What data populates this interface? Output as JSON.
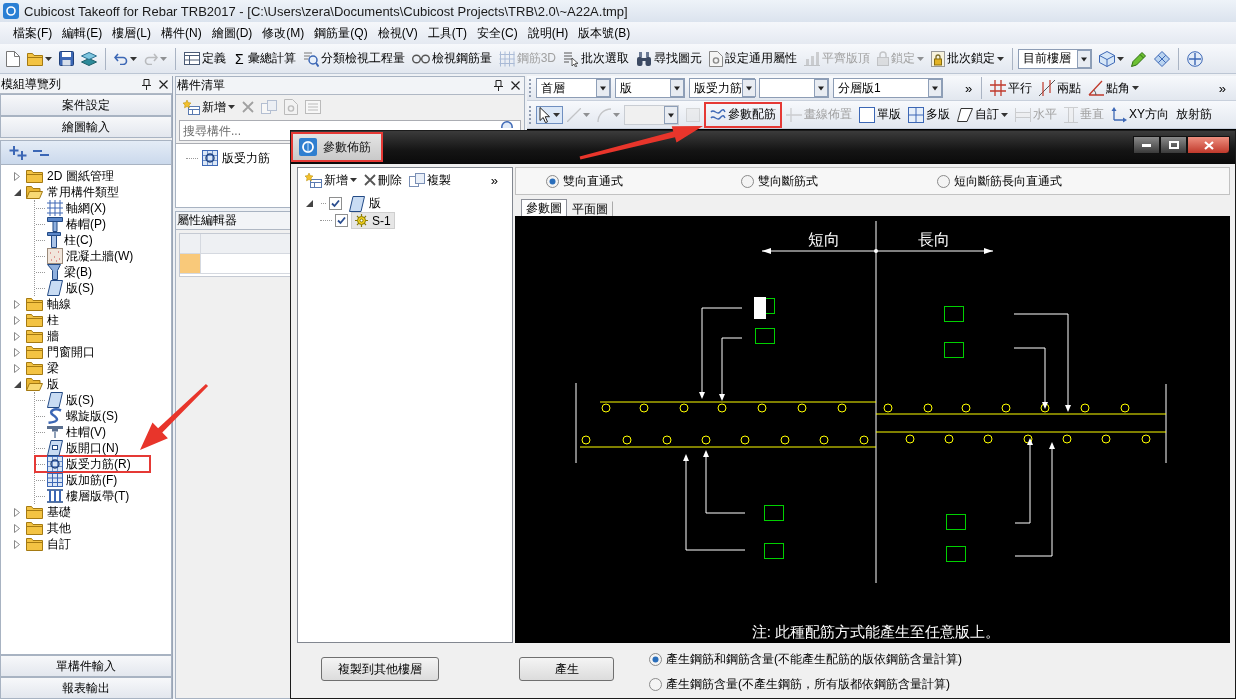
{
  "window": {
    "title": "Cubicost Takeoff for Rebar TRB2017 - [C:\\Users\\zera\\Documents\\Cubicost Projects\\TRB\\2.0\\~A22A.tmp]"
  },
  "menu_bar": [
    "檔案(F)",
    "編輯(E)",
    "樓層(L)",
    "構件(N)",
    "繪圖(D)",
    "修改(M)",
    "鋼筋量(Q)",
    "檢視(V)",
    "工具(T)",
    "安全(C)",
    "說明(H)",
    "版本號(B)"
  ],
  "main_toolbar": [
    {
      "kind": "icon",
      "disabled": false,
      "dropdown": false
    },
    {
      "kind": "icon",
      "disabled": false,
      "dropdown": true
    },
    {
      "kind": "icon",
      "disabled": false,
      "dropdown": false
    },
    {
      "kind": "icon",
      "disabled": false,
      "dropdown": false
    },
    {
      "kind": "separator"
    },
    {
      "kind": "icon",
      "disabled": false,
      "dropdown": true
    },
    {
      "kind": "icon",
      "disabled": true,
      "dropdown": true
    },
    {
      "kind": "separator"
    },
    {
      "kind": "button",
      "label": "定義",
      "disabled": false,
      "dropdown": false
    },
    {
      "kind": "button",
      "glyph": "Σ",
      "label": "彙總計算",
      "disabled": false,
      "dropdown": false
    },
    {
      "kind": "button",
      "label": "分類檢視工程量",
      "disabled": false,
      "dropdown": false
    },
    {
      "kind": "button",
      "label": "檢視鋼筋量",
      "disabled": false,
      "dropdown": false
    },
    {
      "kind": "button",
      "label": "鋼筋3D",
      "disabled": true,
      "dropdown": false
    },
    {
      "kind": "button",
      "label": "批次選取",
      "disabled": false,
      "dropdown": false
    },
    {
      "kind": "button",
      "label": "尋找圖元",
      "disabled": false,
      "dropdown": false
    },
    {
      "kind": "button",
      "label": "設定通用屬性",
      "disabled": false,
      "dropdown": false
    },
    {
      "kind": "button",
      "label": "平齊版頂",
      "disabled": true,
      "dropdown": false
    },
    {
      "kind": "button",
      "label": "鎖定",
      "disabled": true,
      "dropdown": true
    },
    {
      "kind": "button",
      "label": "批次鎖定",
      "disabled": false,
      "dropdown": true
    },
    {
      "kind": "separator"
    },
    {
      "kind": "combo",
      "value": "目前樓層",
      "disabled": false
    },
    {
      "kind": "icon",
      "disabled": false,
      "dropdown": true
    },
    {
      "kind": "icon",
      "disabled": false,
      "dropdown": false
    },
    {
      "kind": "icon",
      "disabled": false,
      "dropdown": false
    },
    {
      "kind": "separator"
    },
    {
      "kind": "icon",
      "disabled": false,
      "dropdown": false
    }
  ],
  "navigator": {
    "title": "模組導覽列",
    "sections": [
      "案件設定",
      "繪圖輸入"
    ],
    "tree": [
      {
        "label": "2D 圖紙管理",
        "expanded": false,
        "highlighted": false
      },
      {
        "label": "常用構件類型",
        "expanded": true,
        "highlighted": false,
        "children": [
          {
            "label": "軸網(X)",
            "highlighted": false
          },
          {
            "label": "椿帽(P)",
            "highlighted": false
          },
          {
            "label": "柱(C)",
            "highlighted": false
          },
          {
            "label": "混凝土牆(W)",
            "highlighted": false
          },
          {
            "label": "梁(B)",
            "highlighted": false
          },
          {
            "label": "版(S)",
            "highlighted": false
          }
        ]
      },
      {
        "label": "軸線",
        "expanded": false,
        "highlighted": false
      },
      {
        "label": "柱",
        "expanded": false,
        "highlighted": false
      },
      {
        "label": "牆",
        "expanded": false,
        "highlighted": false
      },
      {
        "label": "門窗開口",
        "expanded": false,
        "highlighted": false
      },
      {
        "label": "梁",
        "expanded": false,
        "highlighted": false
      },
      {
        "label": "版",
        "expanded": true,
        "highlighted": false,
        "children": [
          {
            "label": "版(S)",
            "highlighted": false
          },
          {
            "label": "螺旋版(S)",
            "highlighted": false
          },
          {
            "label": "柱帽(V)",
            "highlighted": false
          },
          {
            "label": "版開口(N)",
            "highlighted": false
          },
          {
            "label": "版受力筋(R)",
            "highlighted": true
          },
          {
            "label": "版加筋(F)",
            "highlighted": false
          },
          {
            "label": "樓層版帶(T)",
            "highlighted": false
          }
        ]
      },
      {
        "label": "基礎",
        "expanded": false,
        "highlighted": false
      },
      {
        "label": "其他",
        "expanded": false,
        "highlighted": false
      },
      {
        "label": "自訂",
        "expanded": false,
        "highlighted": false
      }
    ],
    "bottom_sections": [
      "單構件輸入",
      "報表輸出"
    ]
  },
  "component_list": {
    "title": "構件清單",
    "toolbar": [
      {
        "kind": "button",
        "label": "新增",
        "disabled": false,
        "dropdown": true
      },
      {
        "kind": "icon",
        "disabled": true,
        "dropdown": false
      },
      {
        "kind": "icon",
        "disabled": true,
        "dropdown": false
      },
      {
        "kind": "icon",
        "disabled": true,
        "dropdown": false
      },
      {
        "kind": "icon",
        "disabled": true,
        "dropdown": false
      }
    ],
    "search": {
      "placeholder": "搜尋構件..."
    },
    "items": [
      {
        "label": "版受力筋",
        "selected": false
      }
    ]
  },
  "property_editor": {
    "title": "屬性編輯器"
  },
  "drawing_toolbar": [
    {
      "kind": "combo",
      "value": "首層",
      "disabled": false
    },
    {
      "kind": "combo",
      "value": "版",
      "disabled": false
    },
    {
      "kind": "combo",
      "value": "版受力筋",
      "disabled": false
    },
    {
      "kind": "combo",
      "disabled": false
    },
    {
      "kind": "combo",
      "value": "分層版1",
      "disabled": false
    },
    {
      "kind": "more",
      "label": "»"
    },
    {
      "kind": "separator"
    },
    {
      "kind": "button",
      "label": "平行",
      "disabled": false,
      "dropdown": false
    },
    {
      "kind": "button",
      "label": "兩點",
      "disabled": false,
      "dropdown": false
    },
    {
      "kind": "button",
      "label": "點角",
      "disabled": false,
      "dropdown": true
    },
    {
      "kind": "more",
      "label": "»"
    }
  ],
  "layout_toolbar": [
    {
      "kind": "icon",
      "disabled": false,
      "dropdown": true,
      "active": true,
      "highlighted": false
    },
    {
      "kind": "icon",
      "disabled": true,
      "dropdown": true,
      "active": false,
      "highlighted": false
    },
    {
      "kind": "icon",
      "disabled": true,
      "dropdown": true,
      "active": false,
      "highlighted": false
    },
    {
      "kind": "combo",
      "disabled": true,
      "active": false,
      "highlighted": false
    },
    {
      "kind": "icon",
      "disabled": true,
      "dropdown": false,
      "active": false,
      "highlighted": false
    },
    {
      "kind": "button",
      "label": "參數配筋",
      "disabled": false,
      "dropdown": false,
      "active": false,
      "highlighted": true
    },
    {
      "kind": "button",
      "label": "畫線佈置",
      "disabled": true,
      "dropdown": false,
      "active": false,
      "highlighted": false
    },
    {
      "kind": "button",
      "label": "單版",
      "disabled": false,
      "dropdown": false,
      "active": false,
      "highlighted": false
    },
    {
      "kind": "button",
      "label": "多版",
      "disabled": false,
      "dropdown": false,
      "active": false,
      "highlighted": false
    },
    {
      "kind": "button",
      "label": "自訂",
      "disabled": false,
      "dropdown": true,
      "active": false,
      "highlighted": false
    },
    {
      "kind": "button",
      "label": "水平",
      "disabled": true,
      "dropdown": false,
      "active": false,
      "highlighted": false
    },
    {
      "kind": "button",
      "label": "垂直",
      "disabled": true,
      "dropdown": false,
      "active": false,
      "highlighted": false
    },
    {
      "kind": "button",
      "label": "XY方向",
      "disabled": false,
      "dropdown": false,
      "active": false,
      "highlighted": false
    },
    {
      "kind": "button",
      "label": "放射筋",
      "disabled": false,
      "dropdown": false,
      "active": false,
      "highlighted": false
    }
  ],
  "dialog": {
    "title": "參數佈筋",
    "highlighted": true,
    "toolbar": [
      {
        "kind": "button",
        "label": "新增",
        "disabled": false,
        "dropdown": true
      },
      {
        "kind": "button",
        "label": "刪除",
        "disabled": false,
        "dropdown": false
      },
      {
        "kind": "button",
        "label": "複製",
        "disabled": false,
        "dropdown": false
      },
      {
        "kind": "more",
        "label": "»"
      }
    ],
    "tree": [
      {
        "label": "版",
        "checked": true,
        "expanded": true,
        "selected": false,
        "children": [
          {
            "label": "S-1",
            "checked": true,
            "selected": true
          }
        ]
      }
    ],
    "layout_options": [
      {
        "label": "雙向直通式",
        "selected": true
      },
      {
        "label": "雙向斷筋式",
        "selected": false
      },
      {
        "label": "短向斷筋長向直通式",
        "selected": false
      }
    ],
    "tabs": [
      {
        "label": "參數圖",
        "selected": true
      },
      {
        "label": "平面圖",
        "selected": false
      }
    ],
    "diagram": {
      "labels": [
        "短向",
        "長向"
      ],
      "note": "注: 此種配筋方式能產生至任意版上。"
    },
    "buttons": [
      "複製到其他樓層",
      "產生"
    ],
    "output_options": [
      {
        "label": "產生鋼筋和鋼筋含量(不能產生配筋的版依鋼筋含量計算)",
        "selected": true
      },
      {
        "label": "產生鋼筋含量(不產生鋼筋，所有版都依鋼筋含量計算)",
        "selected": false
      }
    ]
  }
}
